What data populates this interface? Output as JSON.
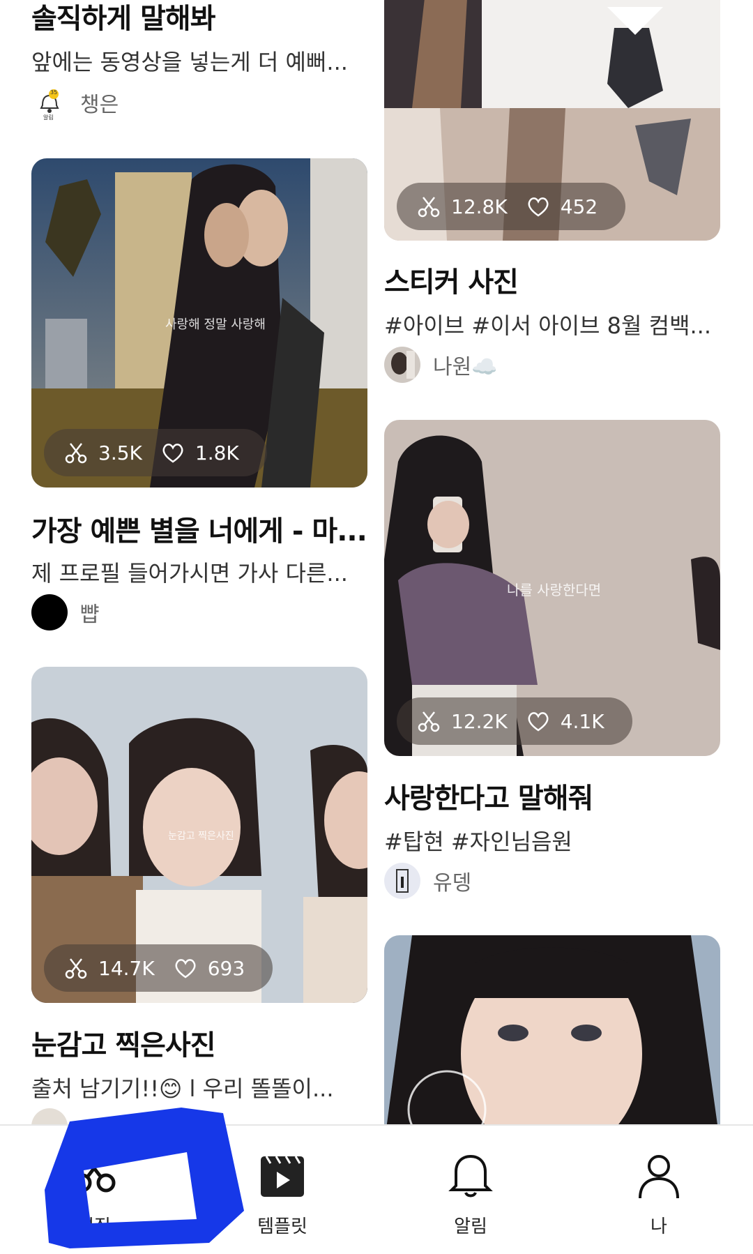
{
  "cards": [
    {
      "title": "솔직하게 말해봐",
      "desc": "앞에는 동영상을 넣는게 더 예뻐...",
      "author": "챙은",
      "badge": "35",
      "badge_label": "알림"
    },
    {
      "title": "",
      "stats": {
        "uses": "12.8K",
        "likes": "452"
      }
    },
    {
      "title": "가장 예쁜 별을 너에게 - 마...",
      "desc": "제 프로필 들어가시면 가사 다른...",
      "author": "뺩",
      "overlay": "사랑해 정말 사랑해",
      "stats": {
        "uses": "3.5K",
        "likes": "1.8K"
      }
    },
    {
      "title": "스티커 사진",
      "desc": "#아이브 #이서 아이브 8월 컴백...",
      "author": "나원☁️"
    },
    {
      "title": "사랑한다고 말해줘",
      "desc": "#탑현 #자인님음원",
      "author": "유뎅",
      "overlay": "나를 사랑한다면",
      "stats": {
        "uses": "12.2K",
        "likes": "4.1K"
      }
    },
    {
      "title": "눈감고 찍은사진",
      "desc": "출처 남기기!!😊 l 우리 똘똘이...",
      "author": "",
      "overlay": "눈감고 찍은사진",
      "stats": {
        "uses": "14.7K",
        "likes": "693"
      }
    }
  ],
  "nav": {
    "items": [
      {
        "label": "편집",
        "icon": "scissors-icon",
        "active": true
      },
      {
        "label": "템플릿",
        "icon": "clapperboard-icon"
      },
      {
        "label": "알림",
        "icon": "bell-icon"
      },
      {
        "label": "나",
        "icon": "person-icon"
      }
    ]
  },
  "colors": {
    "scribble": "#1638e8",
    "stats_bg": "rgba(70,60,55,0.55)"
  }
}
